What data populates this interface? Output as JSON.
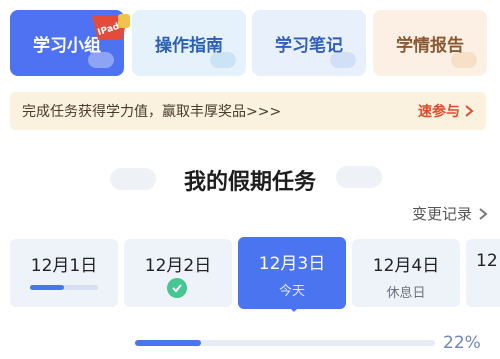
{
  "tabs": [
    {
      "label": "学习小组",
      "active": true
    },
    {
      "label": "操作指南",
      "active": false
    },
    {
      "label": "学习笔记",
      "active": false
    },
    {
      "label": "学情报告",
      "active": false
    }
  ],
  "badge": {
    "label": "IPad"
  },
  "promo": {
    "text": "完成任务获得学力值，赢取丰厚奖品>>>",
    "cta": "速参与"
  },
  "section": {
    "title": "我的假期任务"
  },
  "history": {
    "label": "变更记录"
  },
  "days": [
    {
      "date": "12月1日",
      "sub": "",
      "progress": 0.5
    },
    {
      "date": "12月2日",
      "sub": "",
      "done": true
    },
    {
      "date": "12月3日",
      "sub": "今天",
      "active": true
    },
    {
      "date": "12月4日",
      "sub": "休息日"
    },
    {
      "date": "12",
      "sub": ""
    }
  ],
  "overall": {
    "progress": 0.22,
    "progress_label": "22%"
  },
  "colors": {
    "accent": "#4b74f0",
    "cta": "#e24a2c",
    "banner": "#fbf1df"
  },
  "icons": {
    "history": "chevron-right-icon",
    "promo": "chevron-right-icon",
    "done": "check-circle-icon"
  }
}
